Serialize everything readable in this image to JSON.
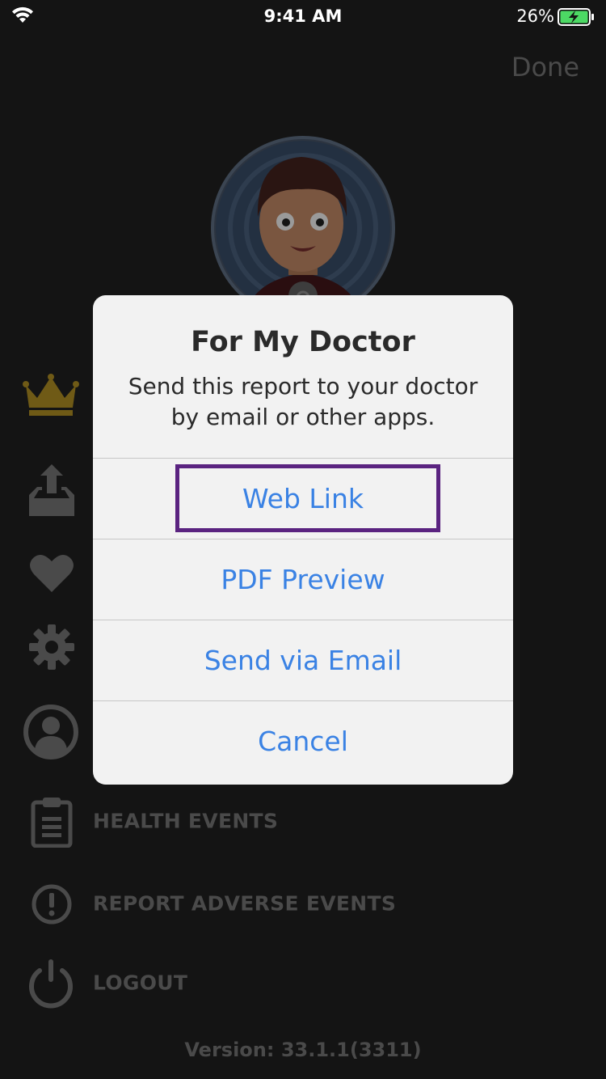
{
  "status_bar": {
    "time": "9:41 AM",
    "battery_percent": "26%",
    "battery_level": 0.26,
    "wifi_icon": "wifi-icon",
    "battery_icon": "battery-charging-icon"
  },
  "header": {
    "done_label": "Done"
  },
  "menu": {
    "items": [
      {
        "icon": "crown-icon",
        "label": ""
      },
      {
        "icon": "share-tray-icon",
        "label": ""
      },
      {
        "icon": "heart-icon",
        "label": ""
      },
      {
        "icon": "gear-icon",
        "label": ""
      },
      {
        "icon": "profile-icon",
        "label": ""
      },
      {
        "icon": "clipboard-icon",
        "label": "HEALTH EVENTS"
      },
      {
        "icon": "exclamation-circle-icon",
        "label": "REPORT ADVERSE EVENTS"
      },
      {
        "icon": "power-icon",
        "label": "LOGOUT"
      }
    ],
    "version": "Version: 33.1.1(3311)"
  },
  "alert": {
    "title": "For My Doctor",
    "message": "Send this report to your doctor by email or other apps.",
    "actions": [
      {
        "label": "Web Link",
        "highlighted": true
      },
      {
        "label": "PDF Preview"
      },
      {
        "label": "Send via Email"
      },
      {
        "label": "Cancel"
      }
    ]
  },
  "colors": {
    "background": "#141414",
    "dim_text": "#4a4a4a",
    "dim_gold": "#6f5a16",
    "alert_bg": "#f2f2f2",
    "action_blue": "#3a82e4",
    "highlight": "#5a2380",
    "battery_green": "#4cd964"
  }
}
